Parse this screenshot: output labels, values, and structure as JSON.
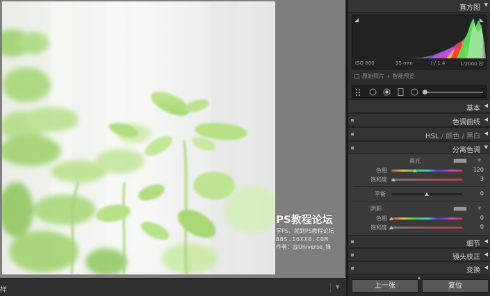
{
  "toolbar": {
    "left_label": "样"
  },
  "watermark": {
    "line1": "PS教程论坛",
    "line2": "学PS，就到PS教程论坛",
    "line3": "BBS.16XX8.COM",
    "line4": "作者：@Universe_锋"
  },
  "histogram": {
    "title": "直方图",
    "iso": "ISO 800",
    "focal": "35 mm",
    "aperture": "f / 1.4",
    "shutter": "1/2000 秒",
    "preview_label": "原始照片 + 智能预览"
  },
  "panels": {
    "basic": "基本",
    "tone_curve": "色调曲线",
    "hsl": {
      "a": "HSL",
      "b": "颜色",
      "c": "黑白",
      "sep": "/"
    },
    "split_toning": "分离色调",
    "detail": "细节",
    "lens": "镜头校正",
    "transform": "变换"
  },
  "split_toning": {
    "highlights_label": "高光",
    "hue_label": "色相",
    "sat_label": "饱和度",
    "highlights_hue": "120",
    "highlights_sat": "3",
    "balance_label": "平衡",
    "balance": "0",
    "shadows_label": "阴影",
    "shadows_hue": "0",
    "shadows_sat": "0",
    "knob_levels": {
      "hl_hue": 0.33,
      "hl_sat": 0.03,
      "balance": 0.5,
      "sh_hue": 0.0,
      "sh_sat": 0.0
    }
  },
  "buttons": {
    "previous": "上一张",
    "reset": "复位"
  },
  "colors": {
    "panel_bg": "#2d2d2d",
    "header_bg": "#333333",
    "button": "#585858"
  }
}
